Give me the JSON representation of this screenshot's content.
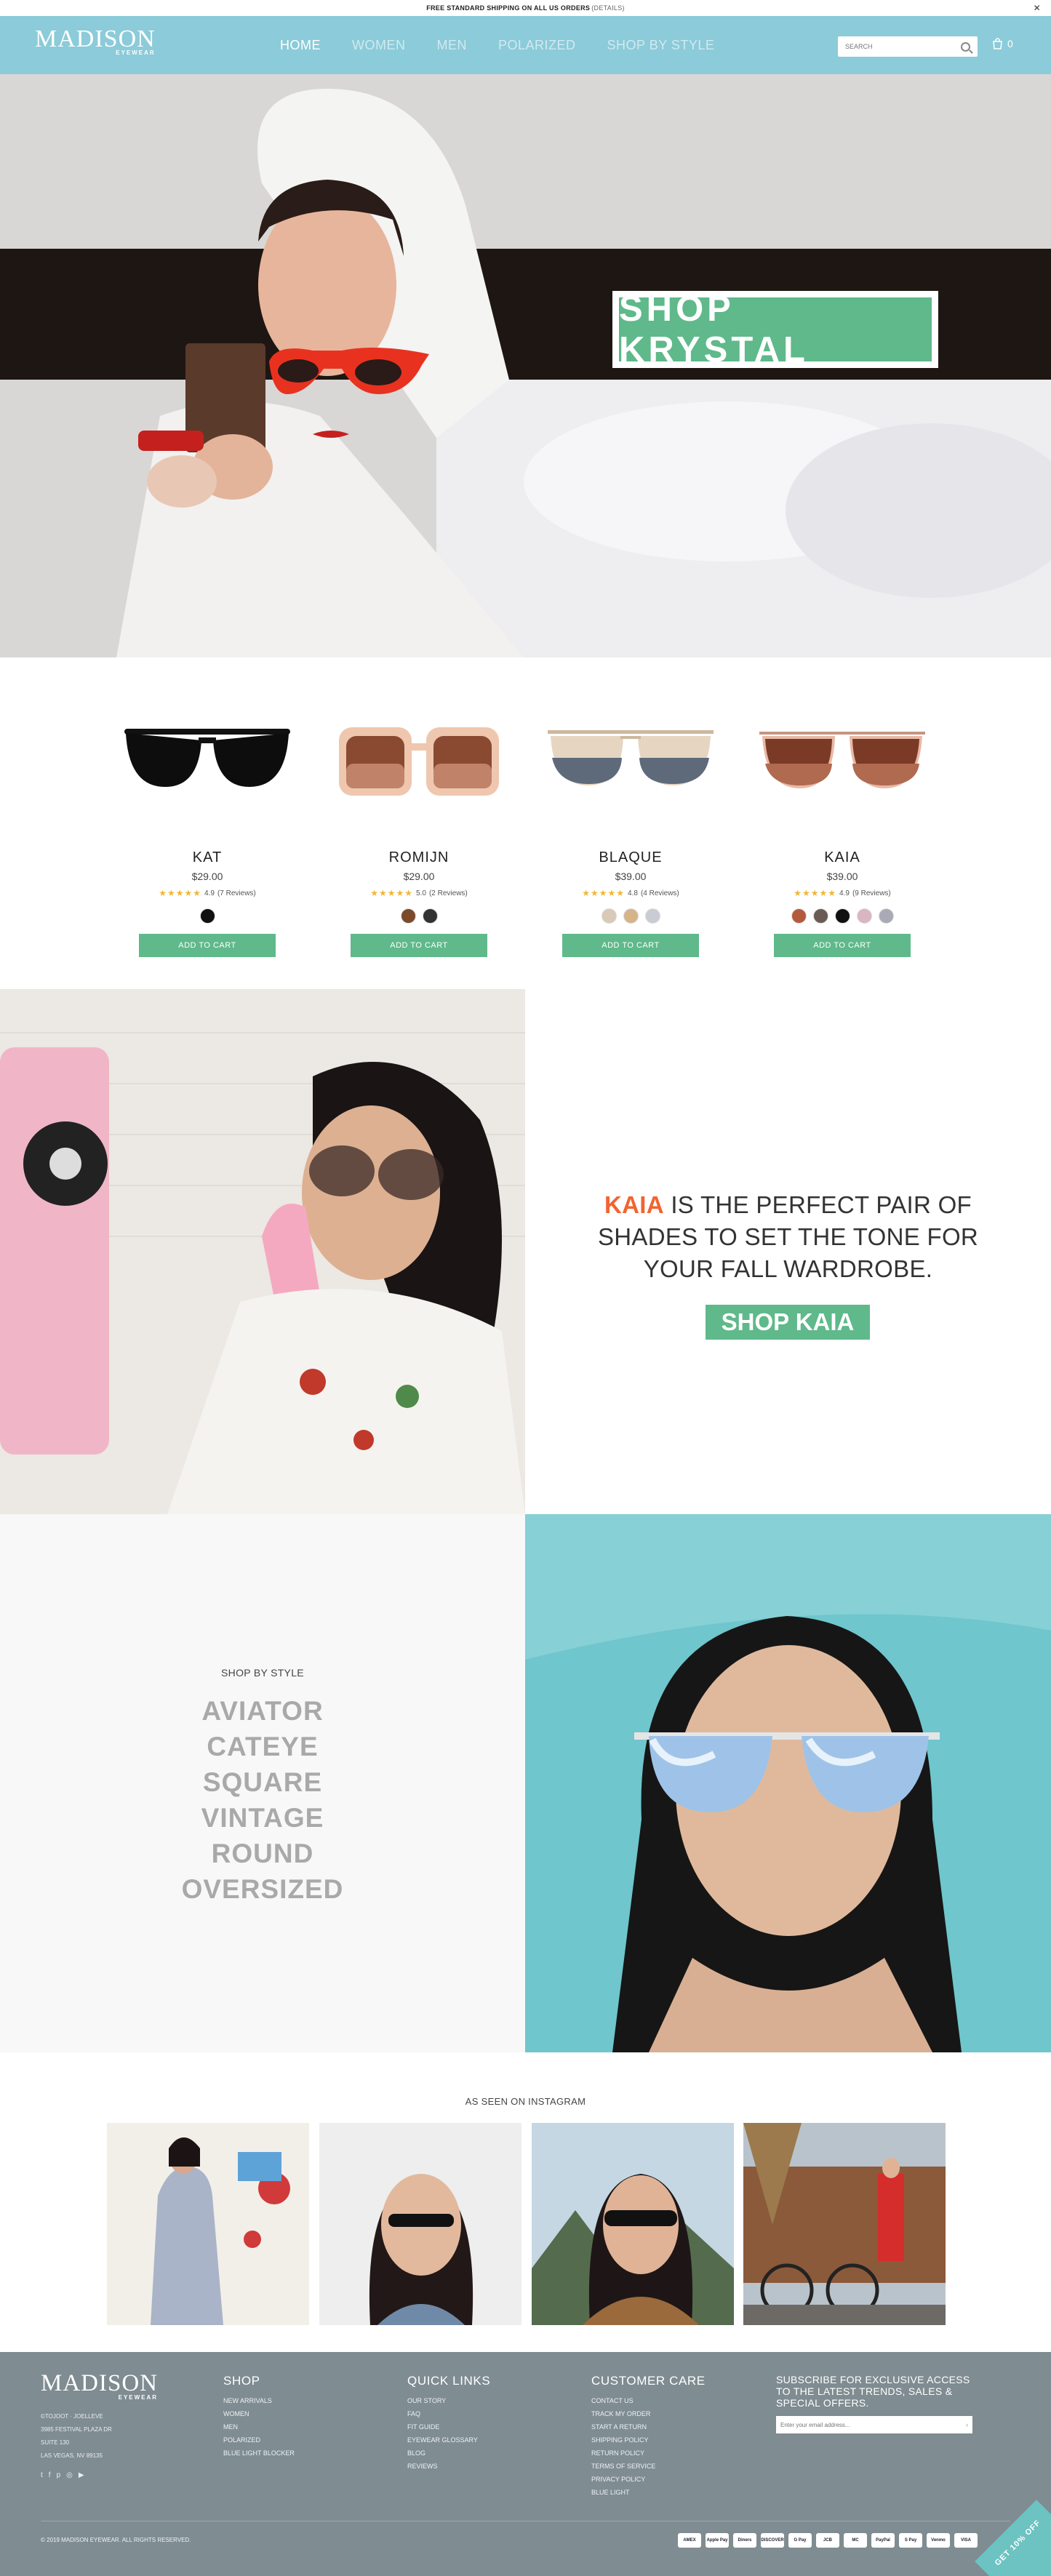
{
  "announcement": {
    "text": "FREE STANDARD SHIPPING ON ALL US ORDERS",
    "details": "(DETAILS)",
    "close": "✕"
  },
  "header": {
    "logo_main": "MADISON",
    "logo_sub": "EYEWEAR",
    "nav": [
      "HOME",
      "WOMEN",
      "MEN",
      "POLARIZED",
      "SHOP BY STYLE"
    ],
    "search_placeholder": "SEARCH",
    "cart_count": "0"
  },
  "hero": {
    "cta": "SHOP KRYSTAL"
  },
  "products": [
    {
      "name": "KAT",
      "price": "$29.00",
      "rating": "4.9",
      "reviews": "(7 Reviews)",
      "swatches": [
        "#111111"
      ],
      "cta": "ADD TO CART"
    },
    {
      "name": "ROMIJN",
      "price": "$29.00",
      "rating": "5.0",
      "reviews": "(2 Reviews)",
      "swatches": [
        "#7a4a2a",
        "#333333"
      ],
      "cta": "ADD TO CART"
    },
    {
      "name": "BLAQUE",
      "price": "$39.00",
      "rating": "4.8",
      "reviews": "(4 Reviews)",
      "swatches": [
        "#d9c9b7",
        "#d6b48a",
        "#c9ccd3"
      ],
      "cta": "ADD TO CART"
    },
    {
      "name": "KAIA",
      "price": "$39.00",
      "rating": "4.9",
      "reviews": "(9 Reviews)",
      "swatches": [
        "#b45a3c",
        "#6a5b55",
        "#111111",
        "#d9b6c2",
        "#a9aab5"
      ],
      "cta": "ADD TO CART"
    }
  ],
  "kaia": {
    "accent": "KAIA",
    "headline": " IS THE PERFECT PAIR OF SHADES TO SET THE TONE FOR YOUR FALL WARDROBE.",
    "cta": "SHOP KAIA"
  },
  "shop_by_style": {
    "label": "SHOP BY STYLE",
    "styles": [
      "AVIATOR",
      "CATEYE",
      "SQUARE",
      "VINTAGE",
      "ROUND",
      "OVERSIZED"
    ]
  },
  "instagram": {
    "title": "AS SEEN ON INSTAGRAM"
  },
  "footer": {
    "logo_main": "MADISON",
    "logo_sub": "EYEWEAR",
    "address": [
      "©TOJOOT · JOELLEVE",
      "3985 FESTIVAL PLAZA DR",
      "SUITE 130",
      "LAS VEGAS, NV 89135"
    ],
    "shop_title": "SHOP",
    "shop_links": [
      "NEW ARRIVALS",
      "WOMEN",
      "MEN",
      "POLARIZED",
      "BLUE LIGHT BLOCKER"
    ],
    "quick_title": "QUICK LINKS",
    "quick_links": [
      "OUR STORY",
      "FAQ",
      "FIT GUIDE",
      "EYEWEAR GLOSSARY",
      "BLOG",
      "REVIEWS"
    ],
    "care_title": "CUSTOMER CARE",
    "care_links": [
      "CONTACT US",
      "TRACK MY ORDER",
      "START A RETURN",
      "SHIPPING POLICY",
      "RETURN POLICY",
      "TERMS OF SERVICE",
      "PRIVACY POLICY",
      "BLUE LIGHT"
    ],
    "subscribe_title": "SUBSCRIBE FOR EXCLUSIVE ACCESS TO THE LATEST TRENDS, SALES & SPECIAL OFFERS.",
    "subscribe_placeholder": "Enter your email address...",
    "copyright": "© 2019 MADISON EYEWEAR. ALL RIGHTS RESERVED.",
    "payments": [
      "AMEX",
      "Apple Pay",
      "Diners",
      "DISCOVER",
      "G Pay",
      "JCB",
      "MC",
      "PayPal",
      "S Pay",
      "Venmo",
      "VISA"
    ],
    "promo": "GET 10% OFF"
  },
  "colors": {
    "header": "#8ccbd9",
    "green": "#5fb98a",
    "accent": "#f26430",
    "footer": "#7f8c91"
  }
}
